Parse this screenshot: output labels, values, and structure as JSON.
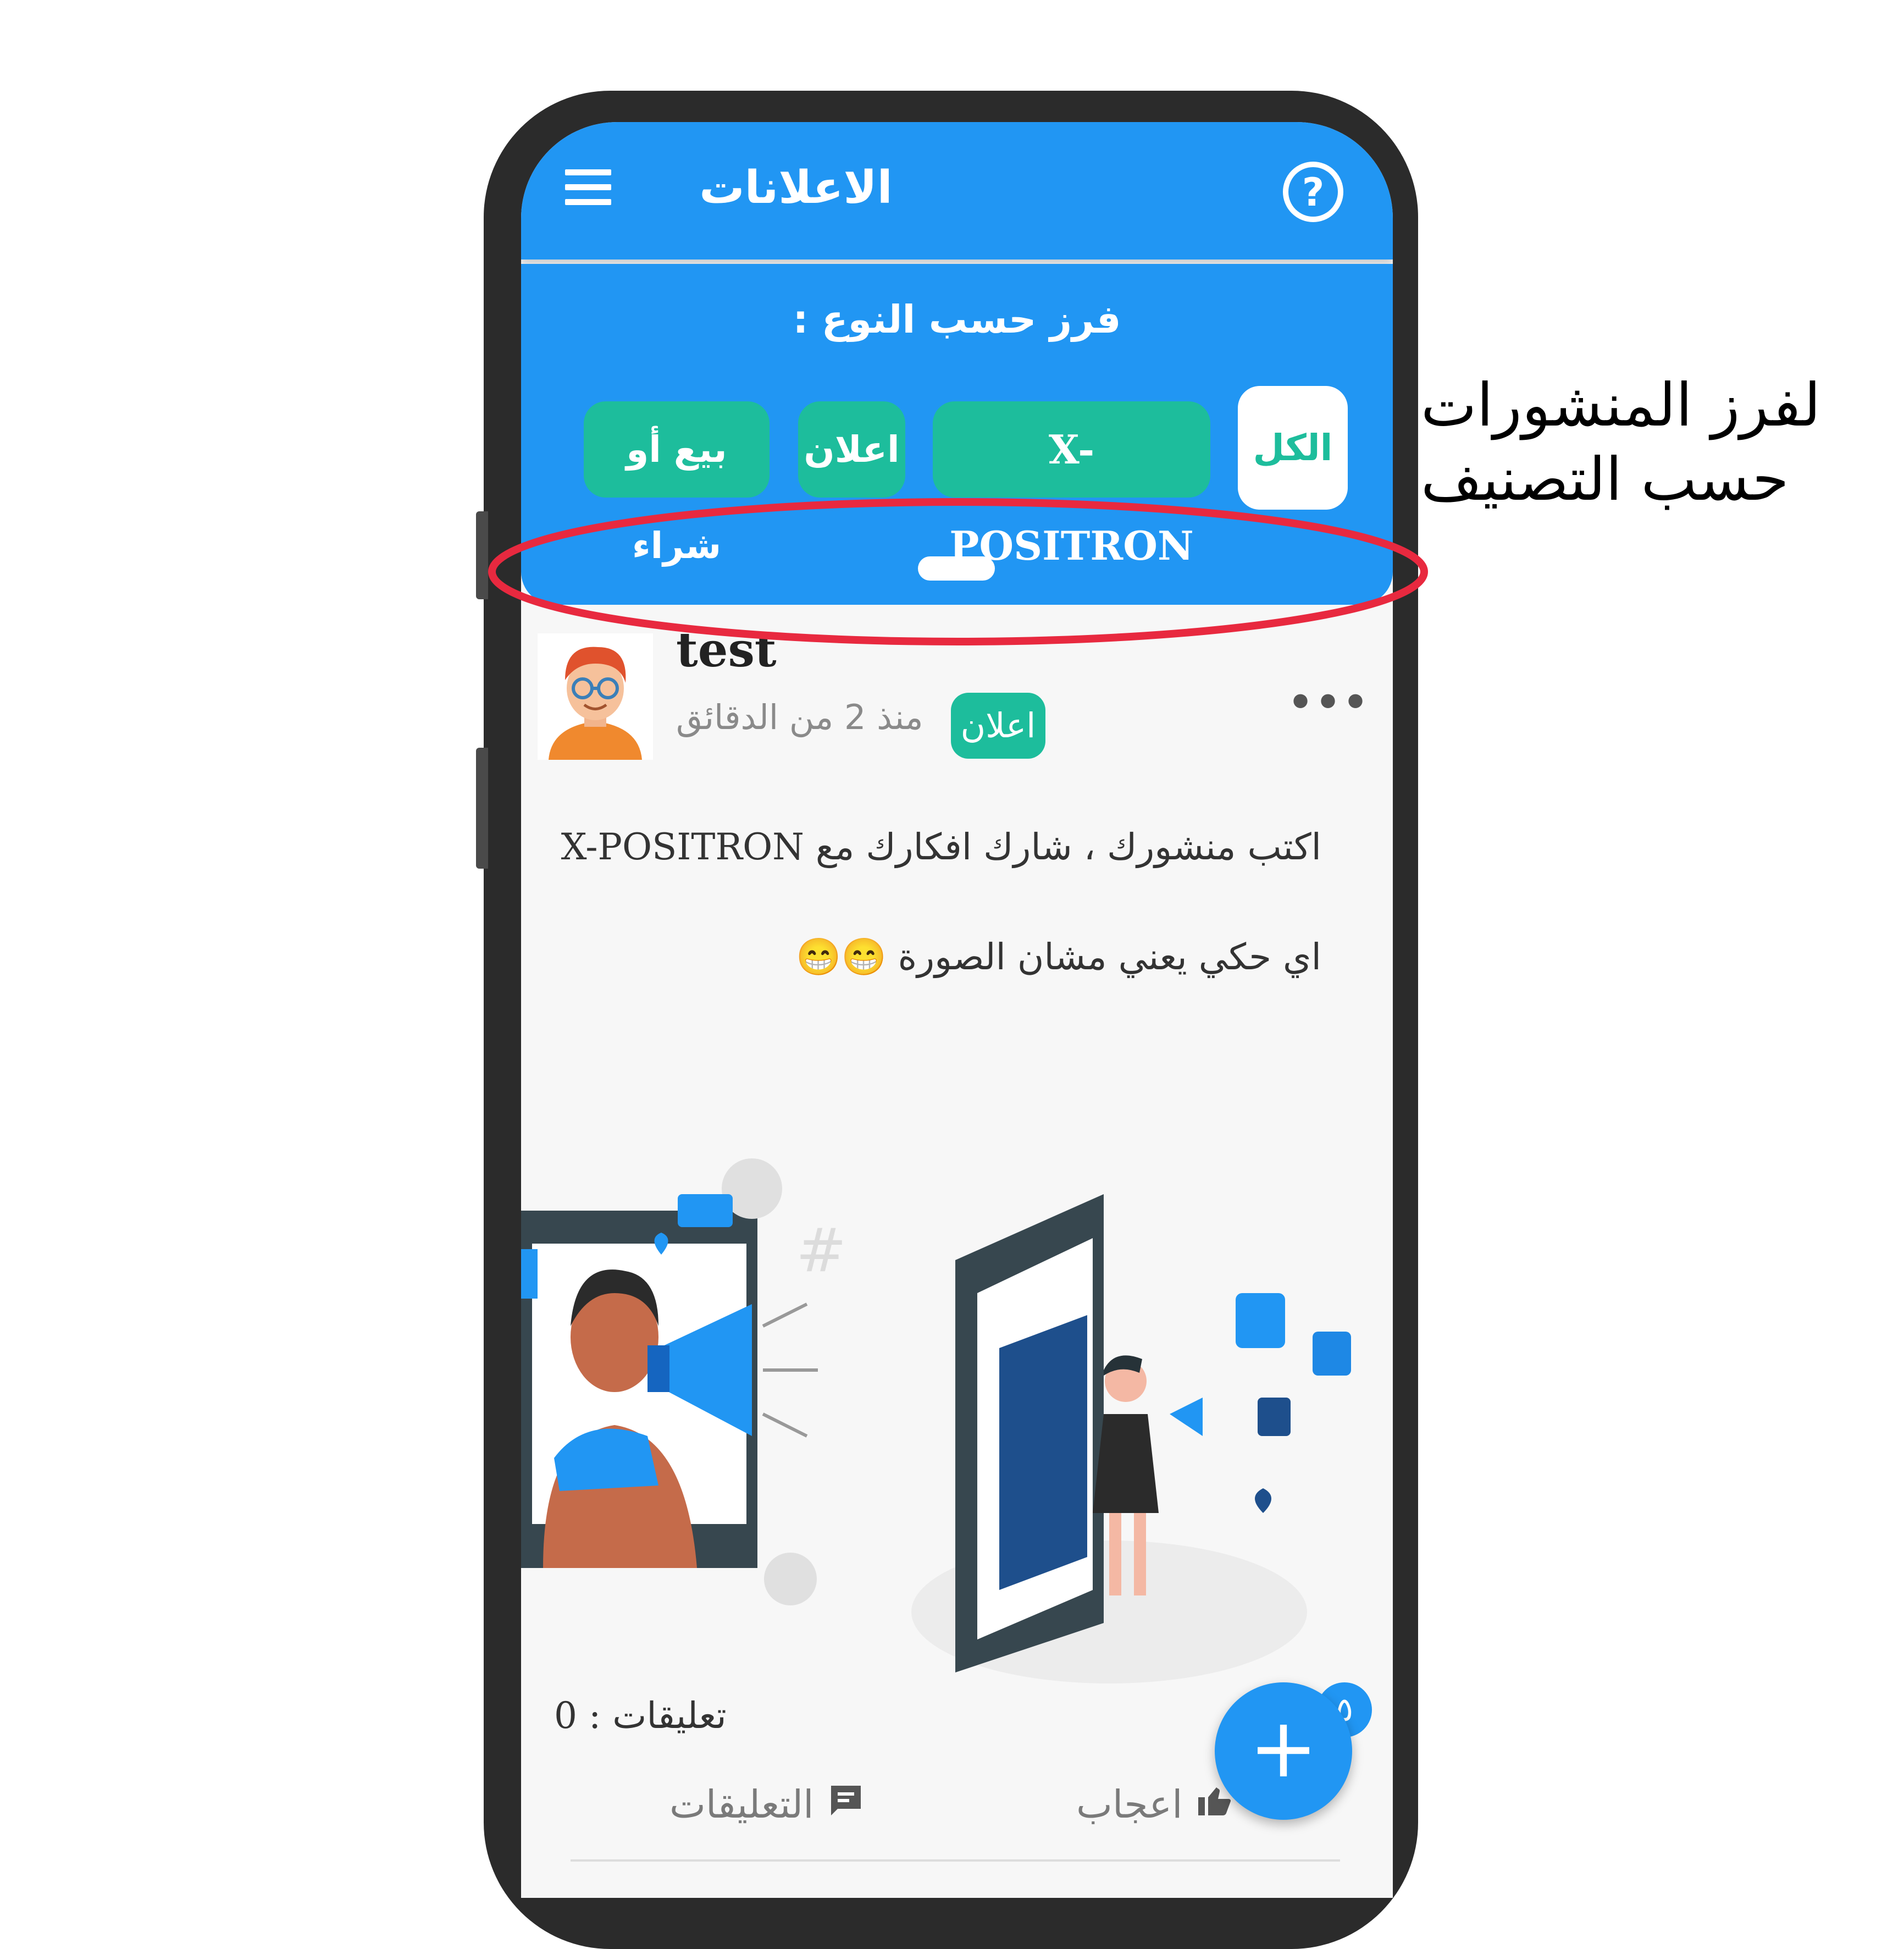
{
  "colors": {
    "primary": "#2196f3",
    "accent": "#1dbd9c",
    "highlight_ring": "#e8293f"
  },
  "appbar": {
    "title": "الاعلانات",
    "menu_icon": "hamburger-menu-icon",
    "help_icon": "question-circle-icon",
    "help_glyph": "?"
  },
  "filter": {
    "title": "فرز حسب النوع :",
    "chips": [
      {
        "label": "الكل",
        "selected": true
      },
      {
        "label": "X-POSITRON",
        "selected": false
      },
      {
        "label": "اعلان",
        "selected": false
      },
      {
        "label": "بيع أو شراء",
        "selected": false
      }
    ]
  },
  "post": {
    "author": "test",
    "time": "منذ 2 من الدقائق",
    "badge": "اعلان",
    "more_glyph": "•••",
    "line1": "اكتب منشورك ، شارك افكارك مع X-POSITRON",
    "line2": "اي حكي يعني مشان الصورة 😁😁",
    "comments_count": "تعليقات : 0",
    "actions": {
      "comments_label": "التعليقات",
      "like_label": "اعجاب"
    }
  },
  "fab": {
    "label": "+",
    "badge": "٥"
  },
  "annotation": {
    "line1": "لفرز المنشورات",
    "line2": "حسب التصنيف"
  }
}
